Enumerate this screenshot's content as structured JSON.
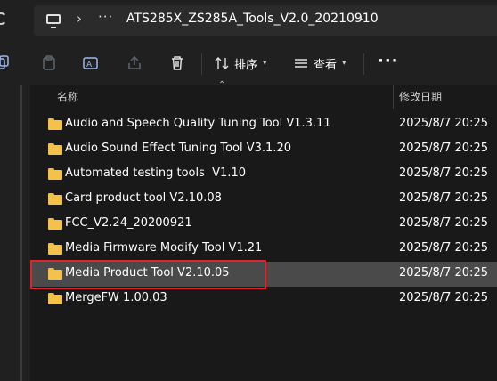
{
  "address_bar": {
    "more_label": "···",
    "path": "ATS285X_ZS285A_Tools_V2.0_20210910",
    "chevron": "›"
  },
  "toolbar": {
    "sort_label": "排序",
    "view_label": "查看",
    "more_label": "···",
    "icons": [
      "copy-icon",
      "paste-icon",
      "rename-icon",
      "share-icon",
      "delete-icon",
      "sort-icon",
      "view-icon"
    ]
  },
  "columns": {
    "name_header": "名称",
    "date_header": "修改日期"
  },
  "files": [
    {
      "name": "Audio and Speech Quality Tuning Tool V1.3.11",
      "date": "2025/8/7 20:25"
    },
    {
      "name": "Audio Sound Effect Tuning Tool V3.1.20",
      "date": "2025/8/7 20:25"
    },
    {
      "name": "Automated testing tools  V1.10",
      "date": "2025/8/7 20:25"
    },
    {
      "name": "Card product tool V2.10.08",
      "date": "2025/8/7 20:25"
    },
    {
      "name": "FCC_V2.24_20200921",
      "date": "2025/8/7 20:25"
    },
    {
      "name": "Media Firmware Modify Tool V1.21",
      "date": "2025/8/7 20:25"
    },
    {
      "name": "Media Product Tool V2.10.05",
      "date": "2025/8/7 20:25"
    },
    {
      "name": "MergeFW 1.00.03",
      "date": "2025/8/7 20:25"
    }
  ],
  "selected_index": 6,
  "colors": {
    "folder": "#f4c24a",
    "highlight_box": "#d9262f",
    "selected_row": "#4a4a4a"
  }
}
